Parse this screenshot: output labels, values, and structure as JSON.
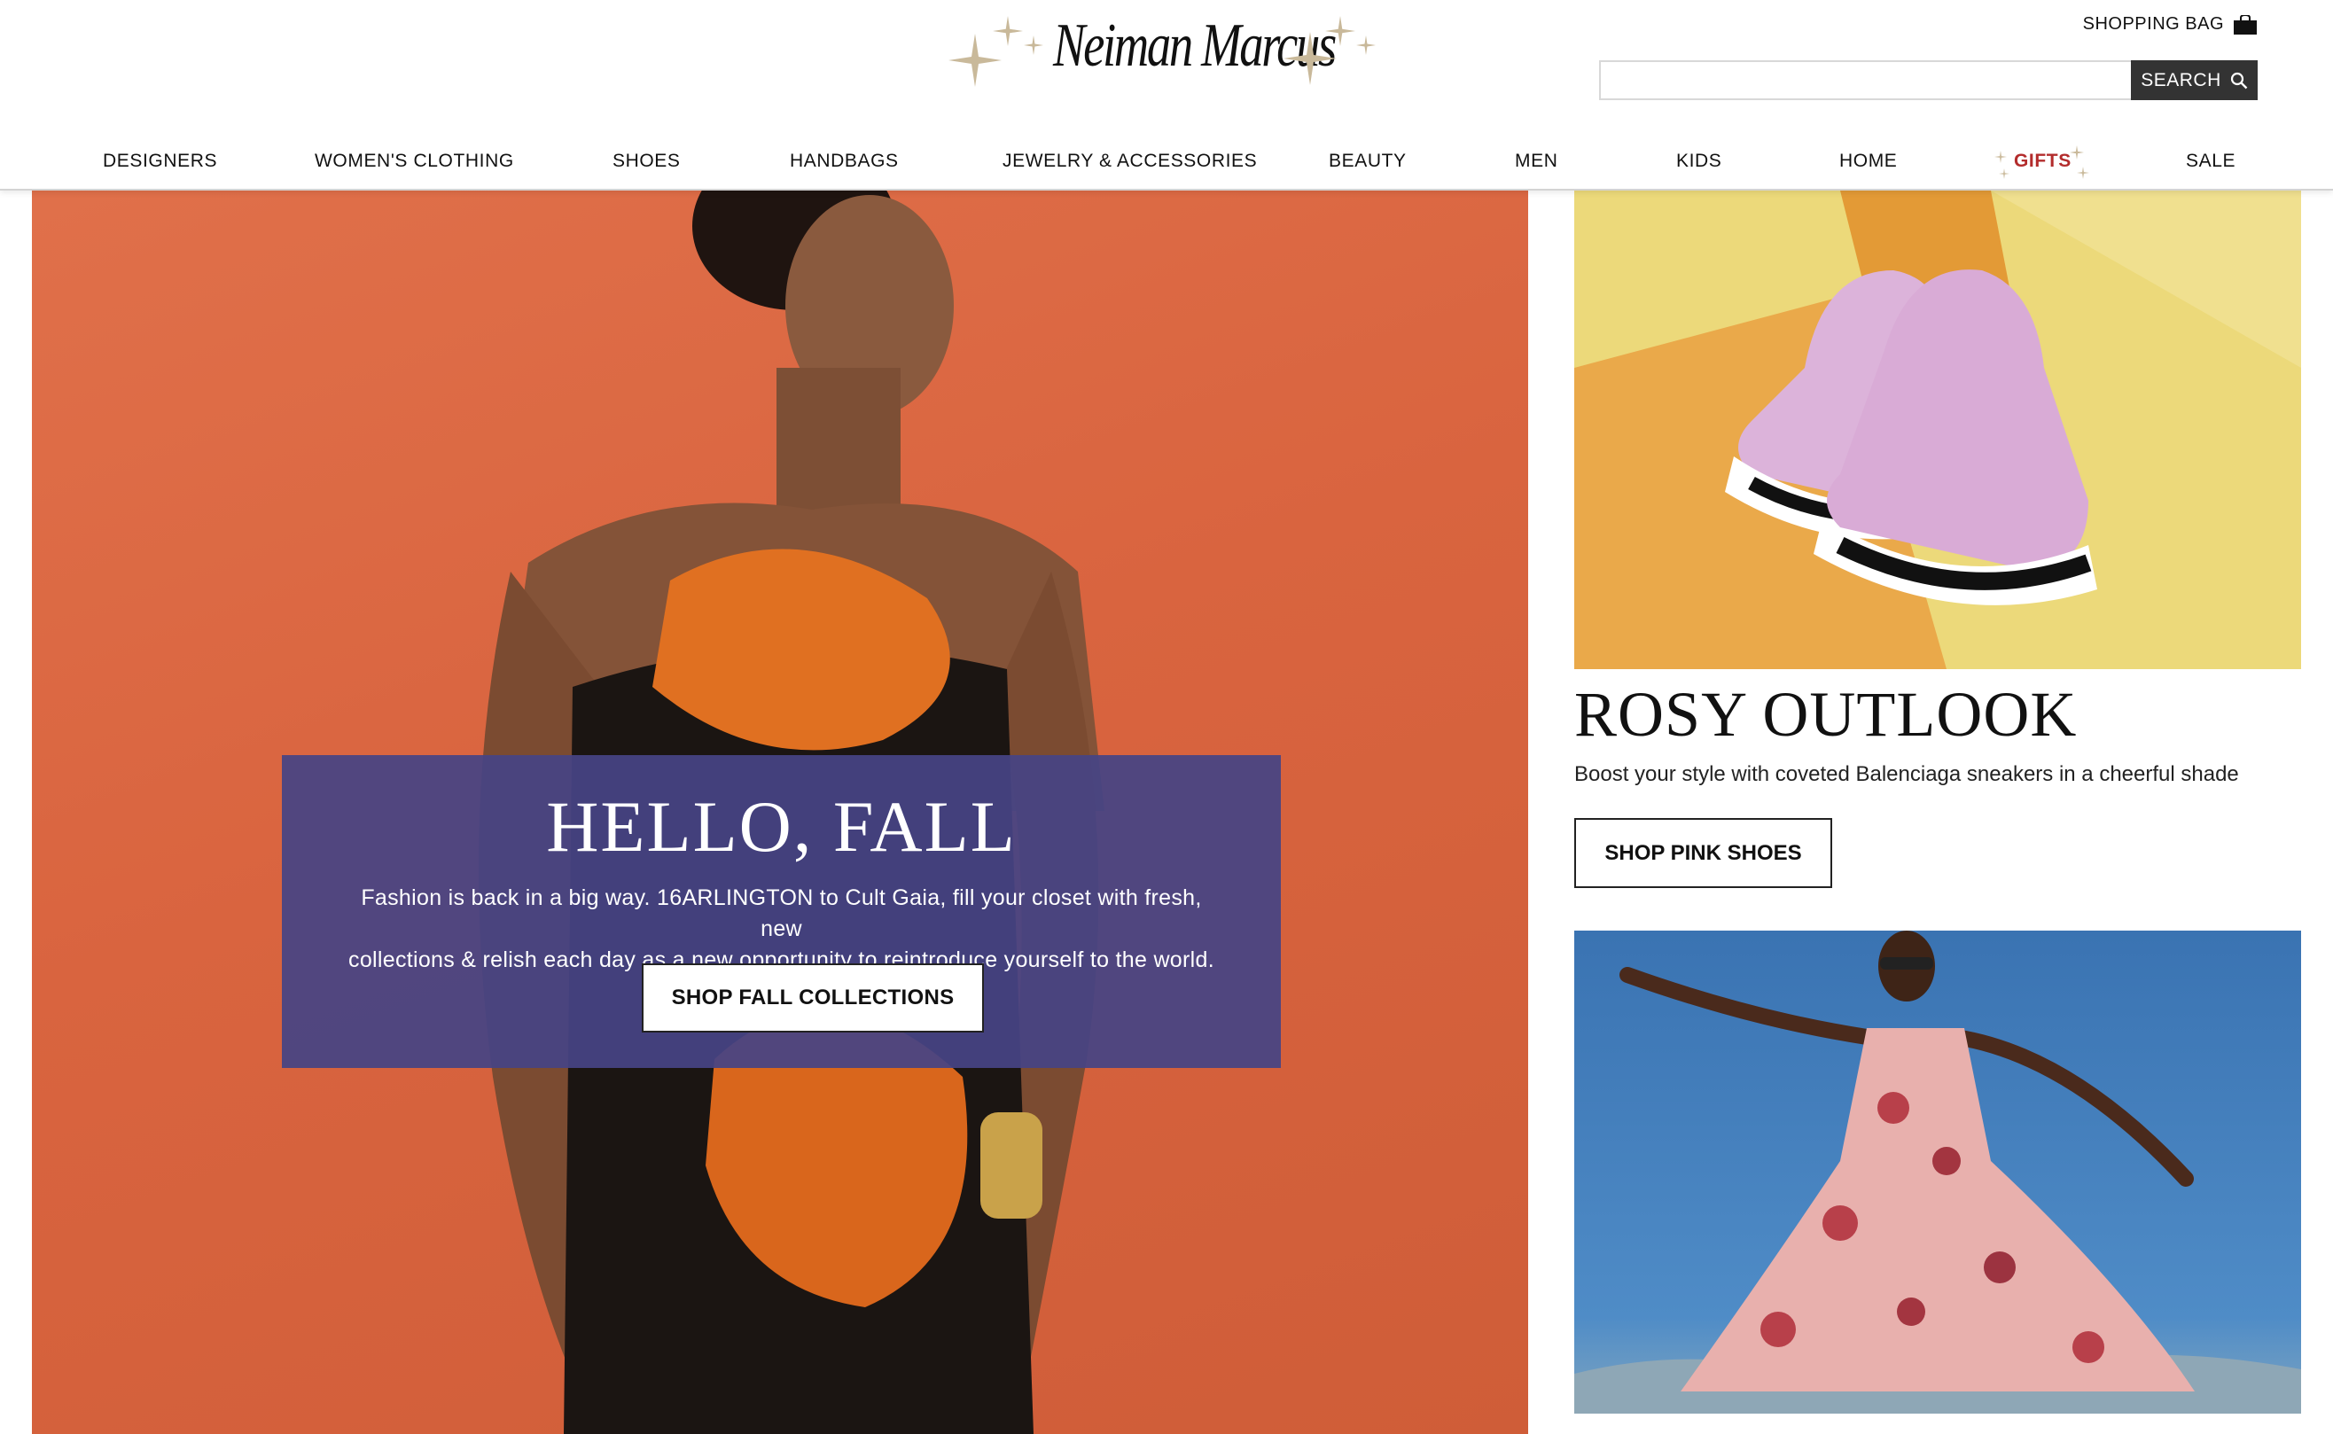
{
  "brand": {
    "name": "Neiman Marcus"
  },
  "header": {
    "shopping_bag_label": "SHOPPING BAG",
    "search_value": "",
    "search_button_label": "SEARCH",
    "icons": [
      "sparkle-icon",
      "shopping-bag-icon",
      "search-icon"
    ]
  },
  "nav": {
    "items": [
      {
        "label": "DESIGNERS"
      },
      {
        "label": "WOMEN'S CLOTHING"
      },
      {
        "label": "SHOES"
      },
      {
        "label": "HANDBAGS"
      },
      {
        "label": "JEWELRY & ACCESSORIES"
      },
      {
        "label": "BEAUTY"
      },
      {
        "label": "MEN"
      },
      {
        "label": "KIDS"
      },
      {
        "label": "HOME"
      },
      {
        "label": "GIFTS"
      },
      {
        "label": "SALE"
      }
    ]
  },
  "hero": {
    "title": "HELLO, FALL",
    "copy_line1": "Fashion is back in a big way. 16ARLINGTON to Cult Gaia, fill your closet with fresh, new",
    "copy_line2": "collections & relish each day as a new opportunity to reintroduce yourself to the world.",
    "cta_label": "SHOP FALL COLLECTIONS"
  },
  "promo": {
    "title": "ROSY OUTLOOK",
    "copy": "Boost your style with coveted Balenciaga sneakers in a cheerful shade",
    "cta_label": "SHOP PINK SHOES"
  },
  "colors": {
    "hero_background": "#d9643f",
    "hero_panel": "#464484",
    "gifts_accent": "#b32c2c",
    "search_button": "#333333",
    "promo_yellow": "#ecd97a",
    "promo_orange": "#eaa94a",
    "sky_blue": "#3f78b6"
  }
}
